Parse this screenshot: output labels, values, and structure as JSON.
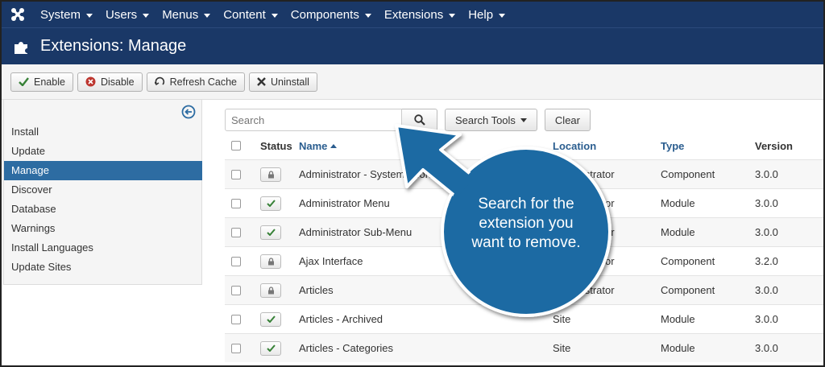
{
  "nav": {
    "items": [
      "System",
      "Users",
      "Menus",
      "Content",
      "Components",
      "Extensions",
      "Help"
    ]
  },
  "header": {
    "title": "Extensions: Manage"
  },
  "toolbar": {
    "enable": "Enable",
    "disable": "Disable",
    "refresh_cache": "Refresh Cache",
    "uninstall": "Uninstall"
  },
  "sidebar": {
    "items": [
      "Install",
      "Update",
      "Manage",
      "Discover",
      "Database",
      "Warnings",
      "Install Languages",
      "Update Sites"
    ],
    "active": "Manage"
  },
  "search": {
    "placeholder": "Search",
    "search_tools": "Search Tools",
    "clear": "Clear"
  },
  "table": {
    "headers": {
      "status": "Status",
      "name": "Name",
      "location": "Location",
      "type": "Type",
      "version": "Version"
    },
    "rows": [
      {
        "status": "locked",
        "name": "Administrator - System Information",
        "location": "Administrator",
        "type": "Component",
        "version": "3.0.0"
      },
      {
        "status": "enabled",
        "name": "Administrator Menu",
        "location": "Administrator",
        "type": "Module",
        "version": "3.0.0"
      },
      {
        "status": "enabled",
        "name": "Administrator Sub-Menu",
        "location": "Administrator",
        "type": "Module",
        "version": "3.0.0"
      },
      {
        "status": "locked",
        "name": "Ajax Interface",
        "location": "Administrator",
        "type": "Component",
        "version": "3.2.0"
      },
      {
        "status": "locked",
        "name": "Articles",
        "location": "Administrator",
        "type": "Component",
        "version": "3.0.0"
      },
      {
        "status": "enabled",
        "name": "Articles - Archived",
        "location": "Site",
        "type": "Module",
        "version": "3.0.0"
      },
      {
        "status": "enabled",
        "name": "Articles - Categories",
        "location": "Site",
        "type": "Module",
        "version": "3.0.0"
      }
    ]
  },
  "callout": {
    "line1": "Search for the",
    "line2": "extension you",
    "line3": "want to remove.",
    "color": "#1e6aa3"
  },
  "colors": {
    "nav_bg": "#1a3867",
    "active_item": "#2d6ca2",
    "enabled_check": "#378137",
    "disable_icon": "#bd362f"
  }
}
